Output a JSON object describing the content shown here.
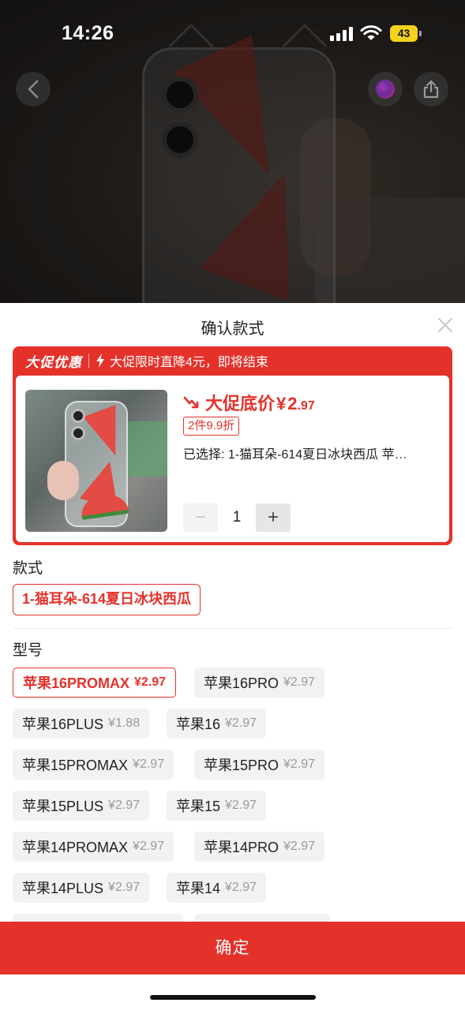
{
  "status_bar": {
    "time": "14:26",
    "battery": "43"
  },
  "sheet": {
    "title": "确认款式",
    "promo": {
      "tag": "大促优惠",
      "text": "大促限时直降4元，即将结束",
      "price_label": "大促底价",
      "price_currency": "¥",
      "price_int": "2",
      "price_dec": ".97",
      "discount": "2件9.9折",
      "selected": "已选择: 1-猫耳朵-614夏日冰块西瓜 苹…",
      "quantity": "1",
      "minus": "−",
      "plus": "+"
    },
    "style_label": "款式",
    "style_option": "1-猫耳朵-614夏日冰块西瓜",
    "model_label": "型号",
    "models": [
      {
        "name": "苹果16PROMAX",
        "price": "¥2.97",
        "selected": true
      },
      {
        "name": "苹果16PRO",
        "price": "¥2.97"
      },
      {
        "name": "苹果16PLUS",
        "price": "¥1.88"
      },
      {
        "name": "苹果16",
        "price": "¥2.97"
      },
      {
        "name": "苹果15PROMAX",
        "price": "¥2.97"
      },
      {
        "name": "苹果15PRO",
        "price": "¥2.97"
      },
      {
        "name": "苹果15PLUS",
        "price": "¥2.97"
      },
      {
        "name": "苹果15",
        "price": "¥2.97"
      },
      {
        "name": "苹果14PROMAX",
        "price": "¥2.97"
      },
      {
        "name": "苹果14PRO",
        "price": "¥2.97"
      },
      {
        "name": "苹果14PLUS",
        "price": "¥2.97"
      },
      {
        "name": "苹果14",
        "price": "¥2.97"
      }
    ],
    "confirm": "确定"
  },
  "colors": {
    "accent": "#e4322b",
    "chip_bg": "#f2f2f2",
    "battery": "#f5d21b"
  }
}
